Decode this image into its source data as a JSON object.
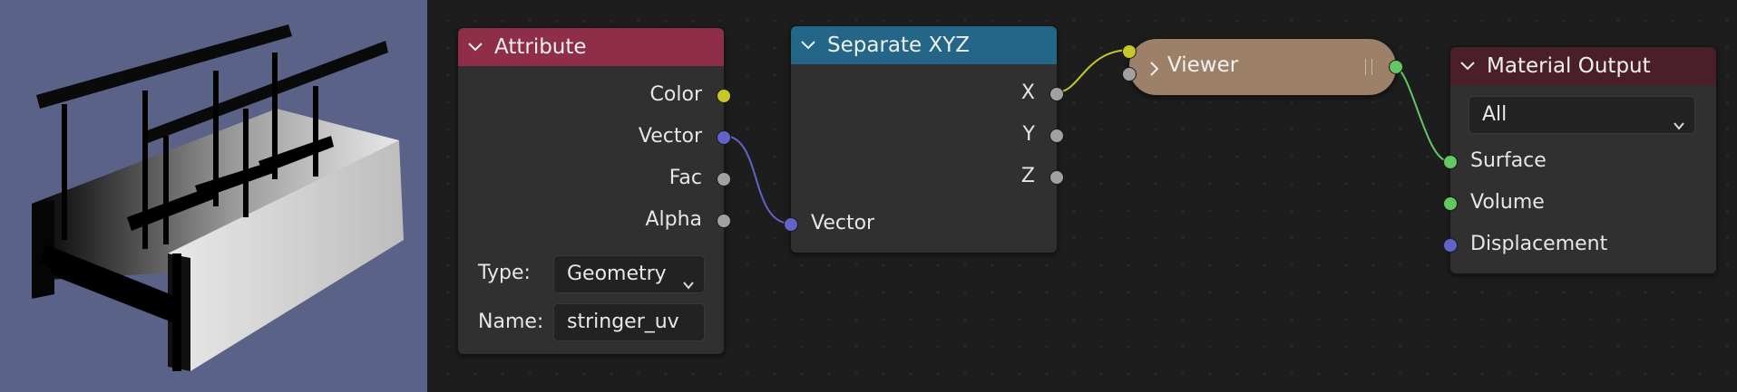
{
  "viewport": {
    "label": "3D viewport preview",
    "background": "#5a6287"
  },
  "nodes": {
    "attribute": {
      "title": "Attribute",
      "header_color": "#8e2e48",
      "outputs": [
        "Color",
        "Vector",
        "Fac",
        "Alpha"
      ],
      "type_label": "Type:",
      "type_value": "Geometry",
      "name_label": "Name:",
      "name_value": "stringer_uv"
    },
    "separate_xyz": {
      "title": "Separate XYZ",
      "header_color": "#236687",
      "outputs": [
        "X",
        "Y",
        "Z"
      ],
      "input": "Vector"
    },
    "viewer": {
      "title": "Viewer",
      "color": "#9c8068"
    },
    "material_output": {
      "title": "Material Output",
      "header_color": "#4a1f29",
      "target": "All",
      "inputs": [
        "Surface",
        "Volume",
        "Displacement"
      ]
    }
  },
  "socket_colors": {
    "color": "#c7c729",
    "vector": "#6363c7",
    "float": "#a1a1a1",
    "shader": "#63c763"
  }
}
